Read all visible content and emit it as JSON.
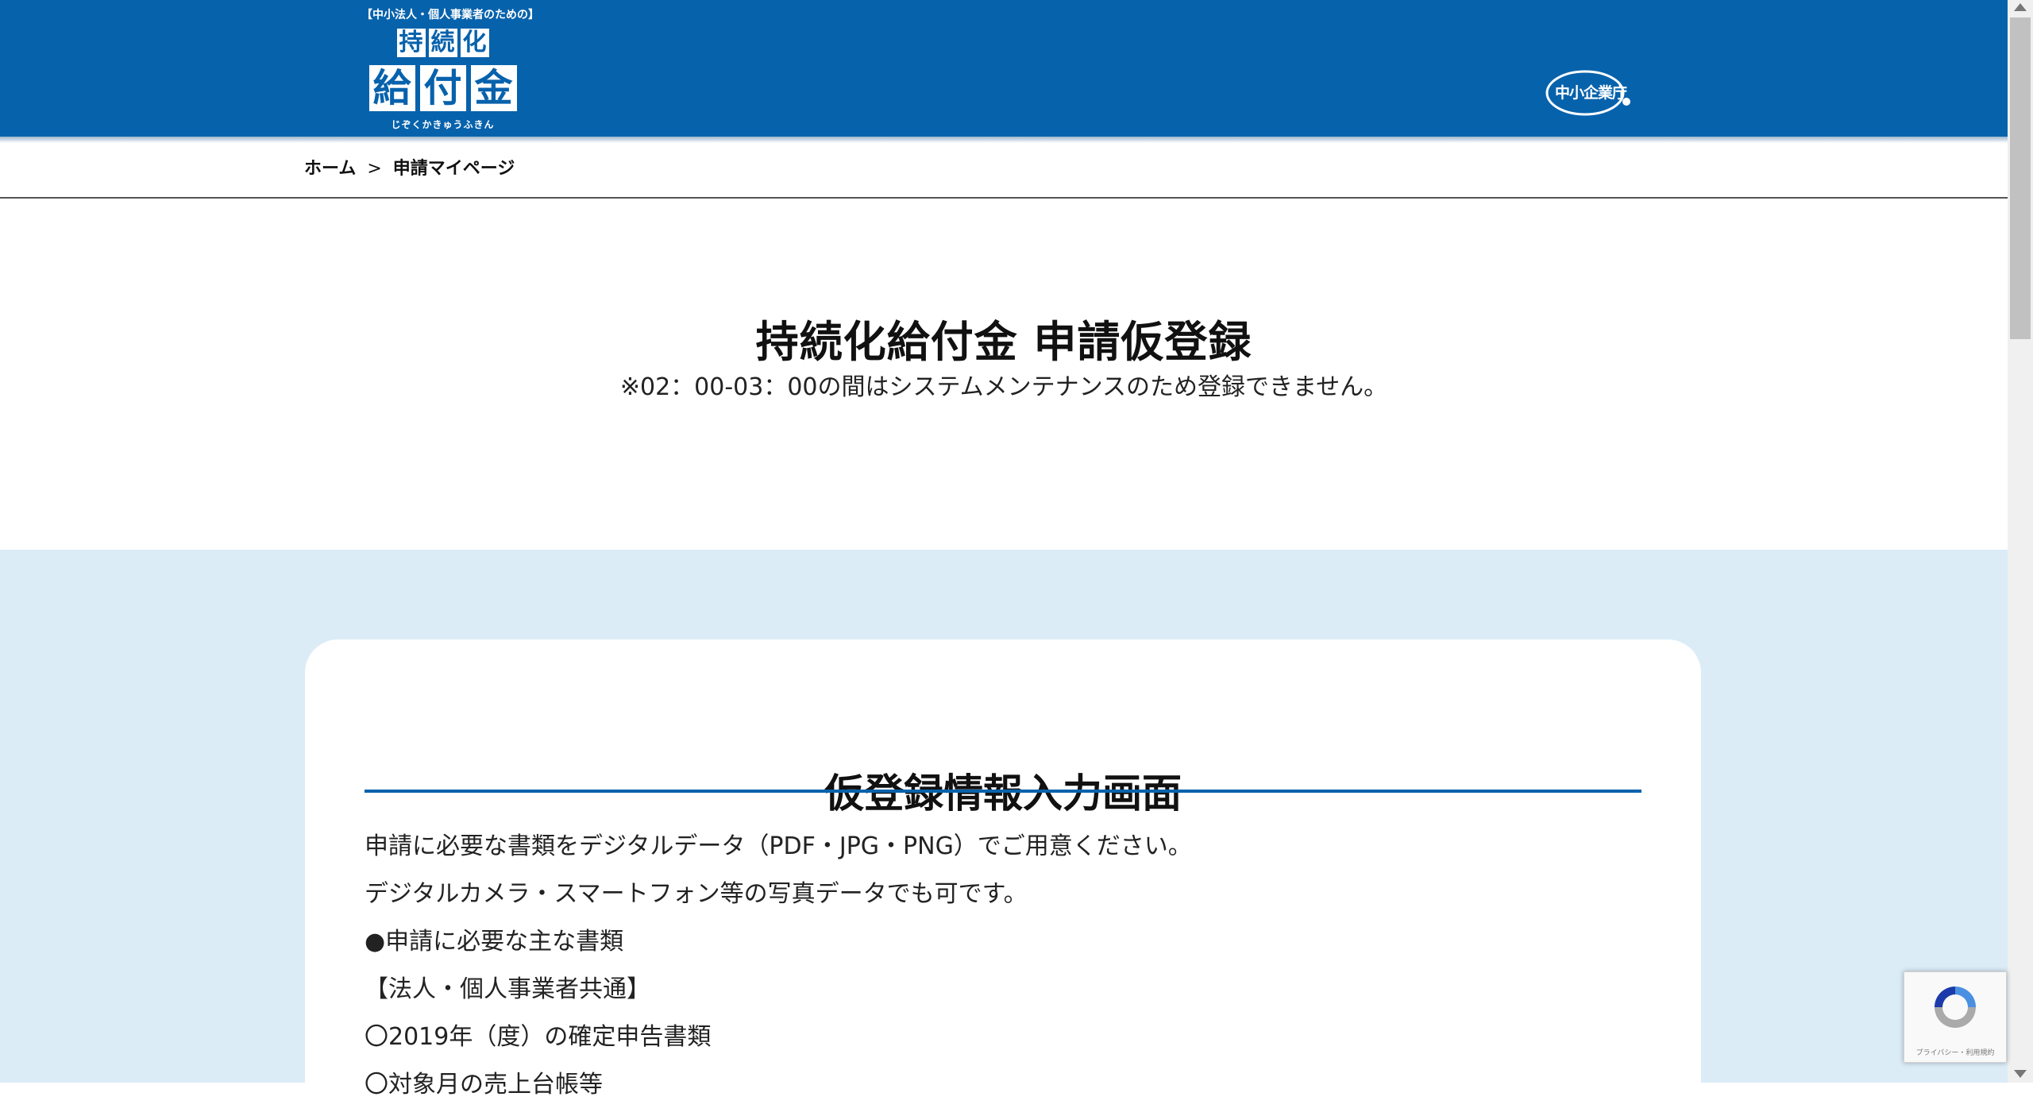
{
  "header": {
    "logo": {
      "top_text": "【中小法人・個人事業者のための】",
      "row1": [
        "持",
        "続",
        "化"
      ],
      "row2": [
        "給",
        "付",
        "金"
      ],
      "bottom_text": "じぞくかきゅうふきん"
    },
    "agency_label": "中小企業庁"
  },
  "breadcrumb": {
    "home": "ホーム",
    "separator": ">",
    "current": "申請マイページ"
  },
  "page": {
    "title": "持続化給付金 申請仮登録",
    "notice": "※02：00-03：00の間はシステムメンテナンスのため登録できません。"
  },
  "card": {
    "title": "仮登録情報入力画面",
    "lines": [
      "申請に必要な書類をデジタルデータ（PDF・JPG・PNG）でご用意ください。",
      "デジタルカメラ・スマートフォン等の写真データでも可です。",
      "●申請に必要な主な書類",
      "【法人・個人事業者共通】",
      "〇2019年（度）の確定申告書類",
      "〇対象月の売上台帳等"
    ]
  },
  "recaptcha": {
    "text": "プライバシー・利用規約"
  },
  "colors": {
    "header_blue": "#0762ac",
    "band_blue": "#dbecf7"
  }
}
